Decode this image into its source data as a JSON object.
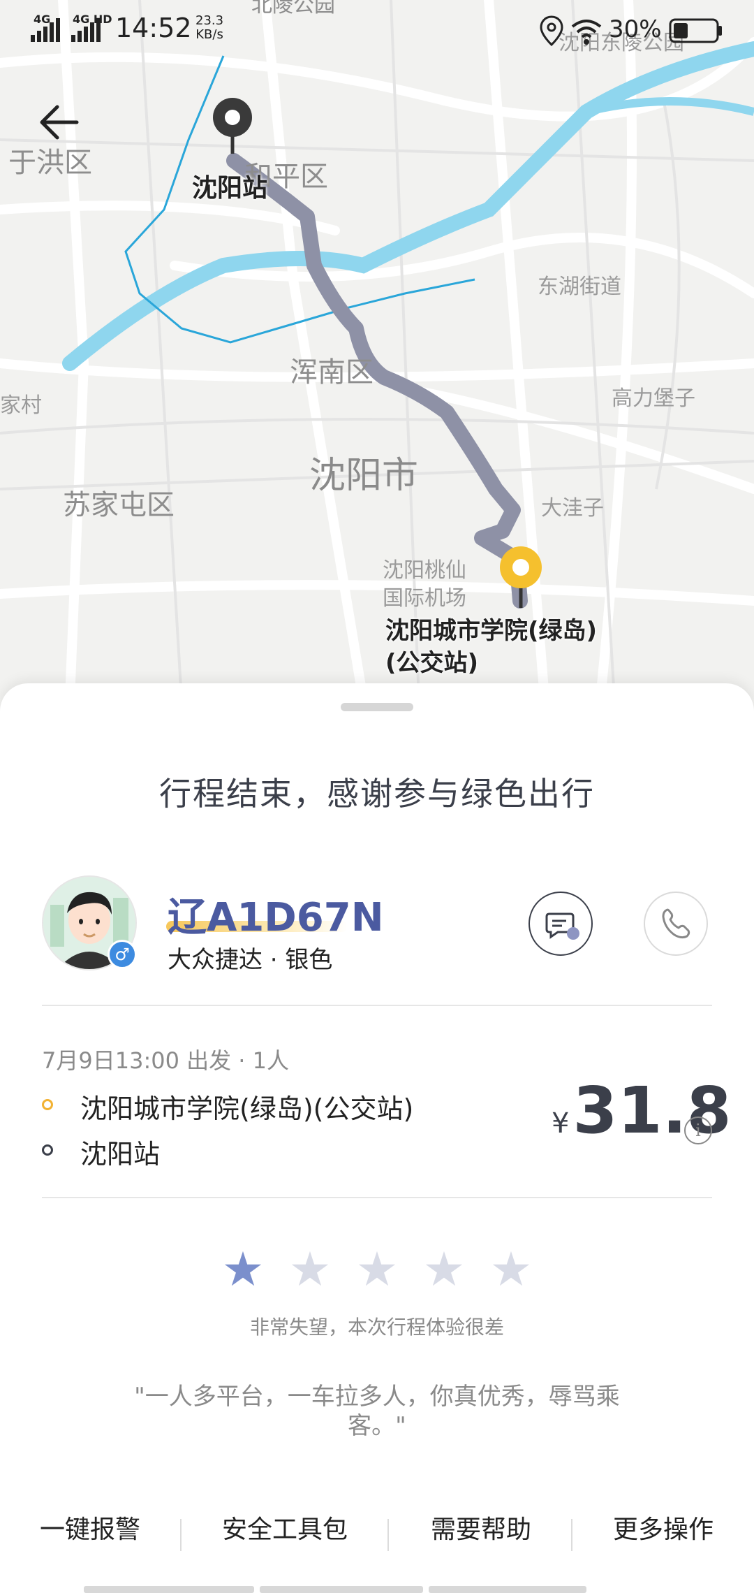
{
  "status_bar": {
    "signal_1": "4G",
    "signal_2": "4G HD",
    "time": "14:52",
    "speed_value": "23.3",
    "speed_unit": "KB/s",
    "battery": "30%"
  },
  "map": {
    "labels": {
      "beiling_park": "北陵公园",
      "dongling_park": "沈阳东陵公园",
      "yuhong": "于洪区",
      "heping": "和平区",
      "shenyang_station": "沈阳站",
      "donghu": "东湖街道",
      "hunnan": "浑南区",
      "gaoli": "高力堡子",
      "shenyang_city": "沈阳市",
      "sujiatun": "苏家屯区",
      "dawazi": "大洼子",
      "airport": "沈阳桃仙\n国际机场",
      "destination": "沈阳城市学院(绿岛)\n(公交站)",
      "village_partial": "家村"
    }
  },
  "sheet": {
    "title": "行程结束，感谢参与绿色出行",
    "driver": {
      "plate": "辽A1D67N",
      "car": "大众捷达 · 银色",
      "gender": "♂"
    },
    "trip": {
      "departure": "7月9日13:00 出发 · 1人",
      "from": "沈阳城市学院(绿岛)(公交站)",
      "to": "沈阳站",
      "currency": "¥",
      "price": "31.8",
      "info_glyph": "i"
    },
    "rating": {
      "stars": 1,
      "max": 5,
      "star_glyph": "★",
      "text": "非常失望，本次行程体验很差",
      "comment": "\"一人多平台，一车拉多人，你真优秀，辱骂乘客。\""
    },
    "actions": [
      "一键报警",
      "安全工具包",
      "需要帮助",
      "更多操作"
    ]
  },
  "colors": {
    "accent": "#4b5aa0",
    "star_active": "#7b8fcc",
    "star_inactive": "#d8dbe6",
    "origin_dot": "#f2b233",
    "dest_dot": "#3b3f4a",
    "route": "#8e91a6",
    "river": "#71c9e8"
  }
}
